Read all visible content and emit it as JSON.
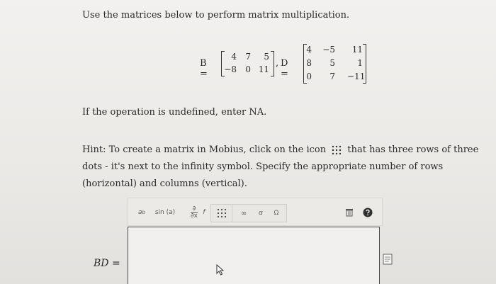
{
  "instruction": "Use the matrices below to perform matrix multiplication.",
  "matrices": {
    "b_label": "B =",
    "b_rows": [
      [
        "4",
        "7",
        "5"
      ],
      [
        "−8",
        "0",
        "11"
      ]
    ],
    "separator": ",",
    "d_label": "D =",
    "d_rows": [
      [
        "4",
        "−5",
        "11"
      ],
      [
        "8",
        "5",
        "1"
      ],
      [
        "0",
        "7",
        "−11"
      ]
    ]
  },
  "undefined_note": "If the operation is undefined, enter NA.",
  "hint": {
    "part1": "Hint: To create a matrix in Mobius, click on the icon",
    "part2": "that has three rows of three dots - it's next to the infinity symbol. Specify the appropriate number of rows (horizontal) and columns (vertical)."
  },
  "toolbar": {
    "superscript": "a",
    "superscript_exp": "b",
    "sin": "sin (a)",
    "deriv_top": "∂",
    "deriv_bottom": "∂x",
    "deriv_f": "f",
    "infinity": "∞",
    "alpha": "α",
    "omega": "Ω"
  },
  "answer_label": "BD ="
}
